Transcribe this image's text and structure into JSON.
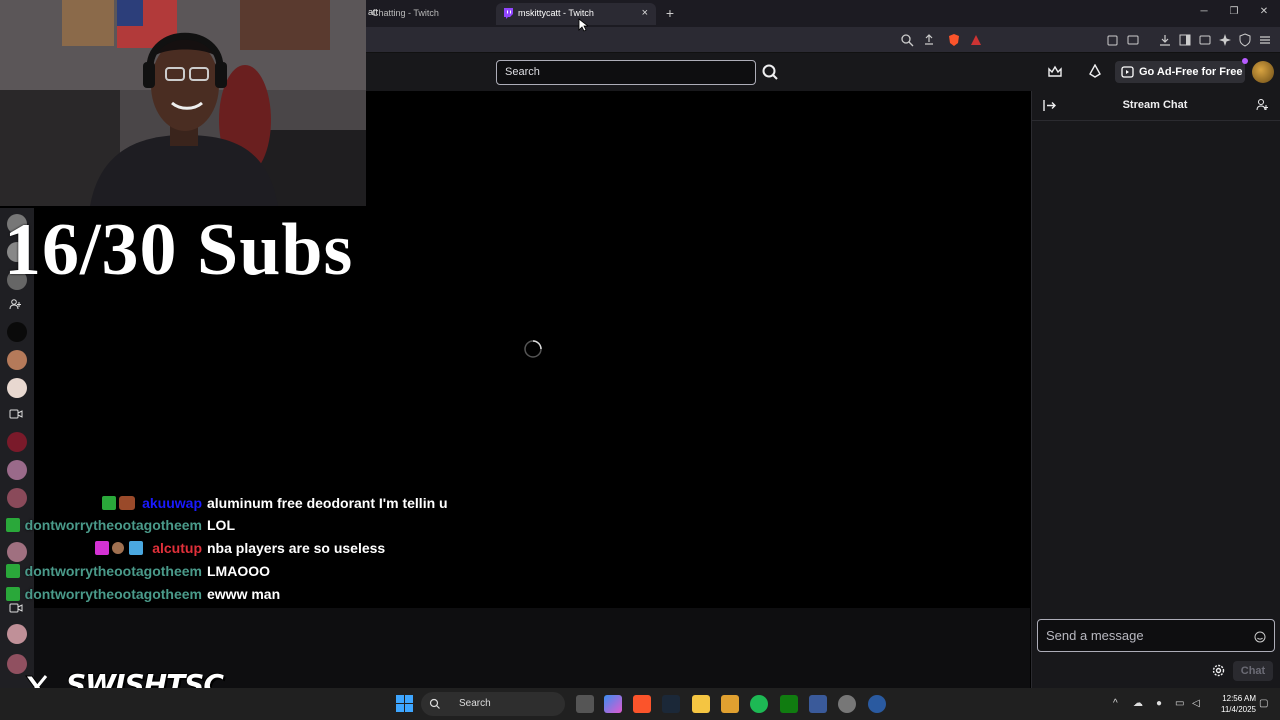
{
  "browser": {
    "tabs": [
      {
        "label": "Chatting - Twitch"
      },
      {
        "label": "mskittycatt - Twitch"
      }
    ],
    "url_fragment": "att",
    "new_tab_symbol": "+",
    "close_symbol": "×"
  },
  "twitch": {
    "search_placeholder": "Search",
    "go_ad_free_label": "Go Ad-Free for Free",
    "chat_title": "Stream Chat",
    "chat_input_placeholder": "Send a message",
    "chat_button": "Chat"
  },
  "overlay": {
    "subs_text": "16/30 Subs",
    "social_handle": "SWISHTSC",
    "chat_messages": [
      {
        "user": "akuuwap",
        "user_color": "#1a1aff",
        "message": "aluminum free deodorant I'm tellin u"
      },
      {
        "user": "dontworrytheootagotheem",
        "user_color": "#4a9a8a",
        "message": "LOL"
      },
      {
        "user": "alcutup",
        "user_color": "#e0303a",
        "message": "nba players are so useless"
      },
      {
        "user": "dontworrytheootagotheem",
        "user_color": "#4a9a8a",
        "message": "LMAOOO"
      },
      {
        "user": "dontworrytheootagotheem",
        "user_color": "#4a9a8a",
        "message": "ewww man"
      }
    ]
  },
  "taskbar": {
    "search_label": "Search",
    "time": "12:56 AM",
    "date": "11/4/2025"
  },
  "colors": {
    "twitch_purple": "#9146ff",
    "chat_bg": "#18181b",
    "nav_bg": "#18181b"
  }
}
